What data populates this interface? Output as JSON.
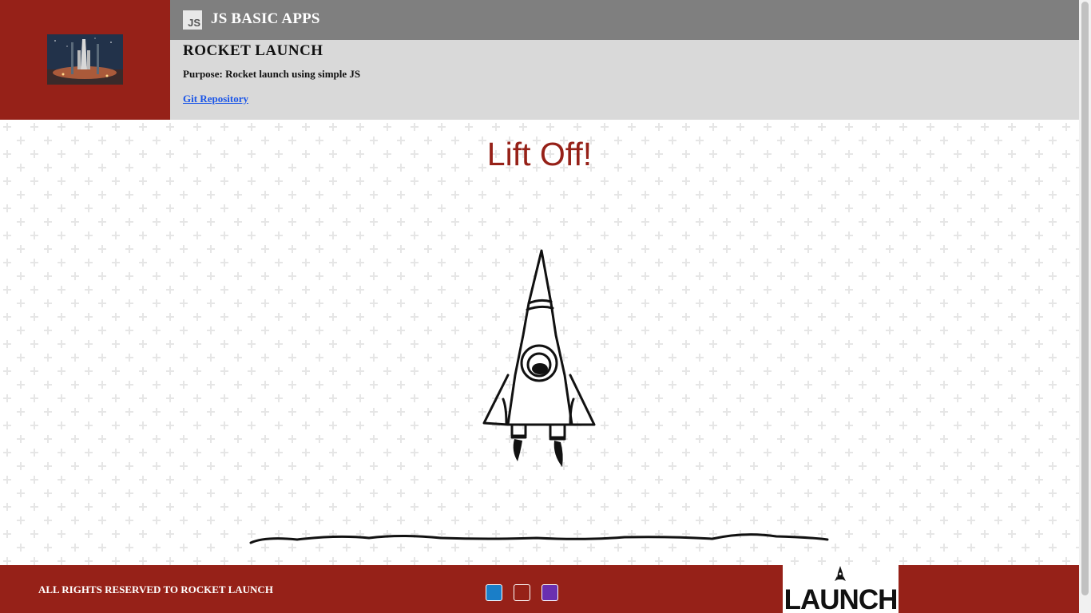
{
  "header": {
    "app_name": "JS BASIC APPS",
    "js_badge": "JS",
    "project_title": "ROCKET LAUNCH",
    "purpose": "Purpose: Rocket launch using simple JS",
    "git_link": "Git Repository"
  },
  "main": {
    "headline": "Lift Off!"
  },
  "footer": {
    "copyright": "ALL RIGHTS RESERVED TO ROCKET LAUNCH",
    "social_icons": [
      "linkedin-icon",
      "github-icon",
      "portfolio-icon"
    ],
    "logo_text": "LAUNCH"
  },
  "colors": {
    "brand_red": "#962118",
    "header_gray": "#7f7f7f",
    "panel_gray": "#d9d9d9",
    "link_blue": "#1a55e8"
  }
}
